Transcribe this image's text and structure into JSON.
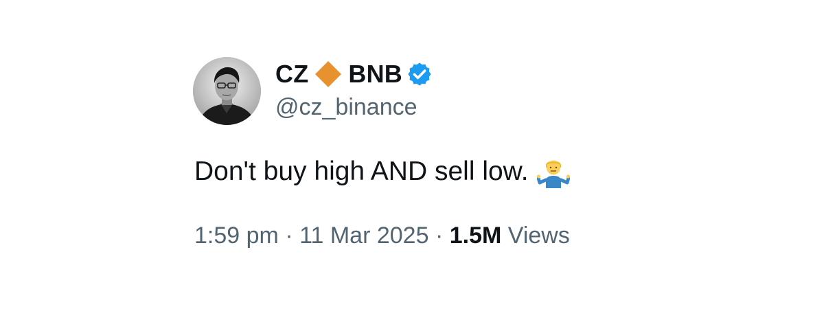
{
  "tweet": {
    "author": {
      "name_first": "CZ",
      "name_second": "BNB",
      "handle": "@cz_binance",
      "diamond_icon": "orange-diamond-icon",
      "verified_icon": "verified-badge-icon",
      "diamond_color": "#e8912f",
      "verified_color": "#1d9bf0"
    },
    "text": "Don't buy high AND sell low.",
    "emoji_icon": "person-shrugging-icon",
    "meta": {
      "time": "1:59 pm",
      "separator": "·",
      "date": "11 Mar 2025",
      "views_count": "1.5M",
      "views_label": "Views"
    }
  }
}
